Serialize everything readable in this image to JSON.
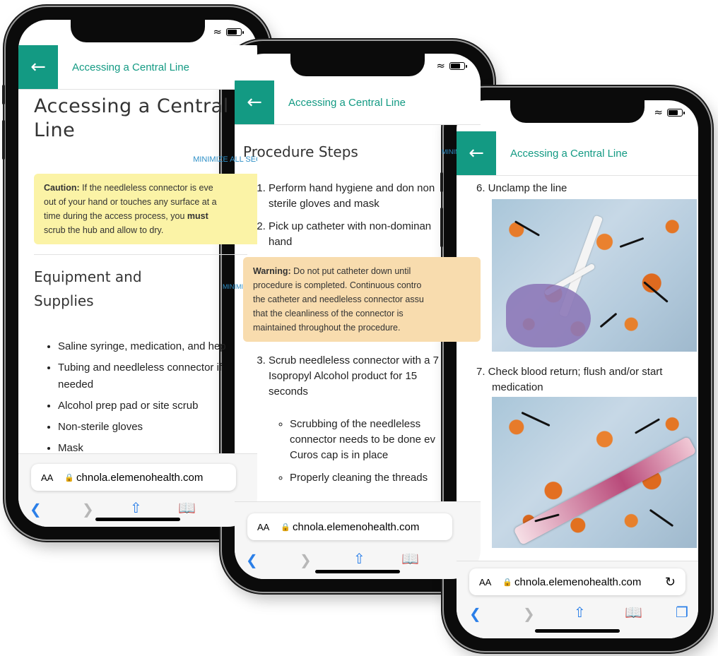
{
  "app": {
    "header_title": "Accessing a Central Line",
    "back_icon": "arrow-left-icon",
    "accent_color": "#139a83",
    "minimize_color": "#2d8fc7"
  },
  "browser": {
    "text_size_label": "AA",
    "url": "chnola.elemenohealth.com",
    "lock_icon": "lock-icon",
    "reload_icon": "reload-icon",
    "toolbar_icons": [
      "back-icon",
      "forward-icon",
      "share-icon",
      "bookmarks-icon",
      "tabs-icon"
    ]
  },
  "phone1": {
    "page_title_line1": "Accessing a Central",
    "page_title_line2": "Line",
    "minimize_all": "MINIMIZE ALL SEC",
    "caution_label": "Caution:",
    "caution_text_1": " If the needleless connector is eve",
    "caution_text_2": "out of your hand or touches any surface at a",
    "caution_text_3": "time during the access process, you ",
    "caution_must": "must",
    "caution_text_4": "scrub the hub and allow to dry.",
    "section_title_line1": "Equipment and",
    "section_title_line2": "Supplies",
    "minimize_section": "MINIMIZE SE",
    "supplies": [
      "Saline syringe, medication, and hep",
      "Tubing and needleless connector if",
      "needed",
      "Alcohol prep pad or site scrub",
      "Non-sterile gloves",
      "Mask"
    ]
  },
  "phone2": {
    "section_title": "Procedure Steps",
    "minimize_section": "MINIMIZE SE",
    "step1_a": "Perform hand hygiene and don non",
    "step1_b": "sterile gloves and mask",
    "step2_a": "Pick up catheter with non-dominan",
    "step2_b": "hand",
    "warning_label": "Warning:",
    "warning_1": " Do not put catheter down until",
    "warning_2": "procedure is completed. Continuous contro",
    "warning_3": "the catheter and needleless connector assu",
    "warning_4": "that the cleanliness of the connector is",
    "warning_5": "maintained throughout the procedure.",
    "step3_a": "Scrub needleless connector with a 7",
    "step3_b": "Isopropyl Alcohol product for 15",
    "step3_c": "seconds",
    "sub1_a": "Scrubbing of the needleless",
    "sub1_b": "connector needs to be done ev",
    "sub1_c": "Curos cap is in place",
    "sub2_a": "Properly cleaning the threads"
  },
  "phone3": {
    "step6": "6. Unclamp the line",
    "step7_a": "7. Check blood return; flush and/or start",
    "step7_b": "medication"
  }
}
